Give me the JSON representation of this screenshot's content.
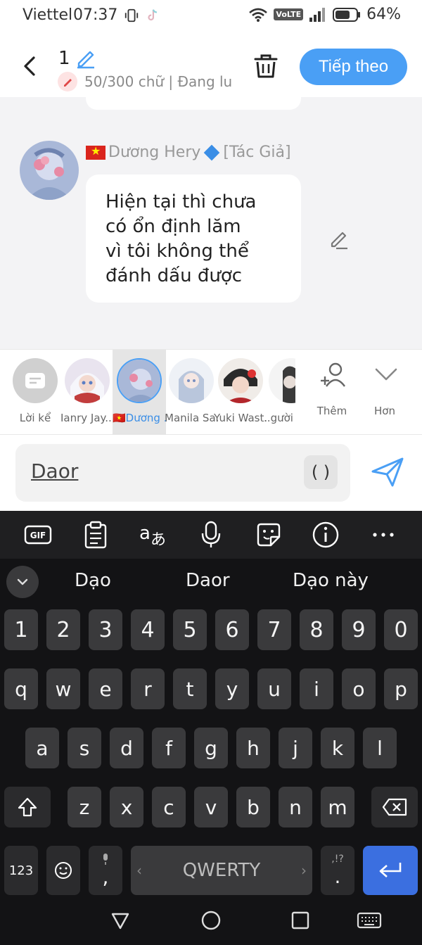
{
  "status_bar": {
    "carrier": "Viettel",
    "time": "07:37",
    "volte": "VoLTE",
    "battery": "64%"
  },
  "header": {
    "title": "1",
    "subtitle": "50/300 chữ | Đang lu",
    "next_label": "Tiếp theo"
  },
  "message": {
    "author": "Dương Hery",
    "author_tag": "[Tác Giả]",
    "text": "Hiện tại thì chưa\ncó ổn định lăm\nvì tôi không thể\nđánh dấu được"
  },
  "characters": [
    {
      "name": "Lời kể"
    },
    {
      "name": "Ianry Jay..."
    },
    {
      "name": "🇻🇳Dương ..."
    },
    {
      "name": "Manila Sa..."
    },
    {
      "name": "Yuki Wast..."
    },
    {
      "name": "..gười"
    }
  ],
  "tools": {
    "add_label": "Thêm",
    "more_label": "Hơn"
  },
  "input": {
    "value": "Daor",
    "paren": "( )"
  },
  "keyboard": {
    "suggestions": [
      "Dạo",
      "Daor",
      "Dạo này"
    ],
    "row_numbers": [
      "1",
      "2",
      "3",
      "4",
      "5",
      "6",
      "7",
      "8",
      "9",
      "0"
    ],
    "row_q": [
      "q",
      "w",
      "e",
      "r",
      "t",
      "y",
      "u",
      "i",
      "o",
      "p"
    ],
    "row_a": [
      "a",
      "s",
      "d",
      "f",
      "g",
      "h",
      "j",
      "k",
      "l"
    ],
    "row_z": [
      "z",
      "x",
      "c",
      "v",
      "b",
      "n",
      "m"
    ],
    "sym_label": "123",
    "comma": ",",
    "space_label": "QWERTY",
    "punct": ".",
    "punct_top": ",!?"
  },
  "colors": {
    "accent": "#4a9ff5",
    "enter": "#3b6fe0",
    "flag": "#da251d"
  }
}
